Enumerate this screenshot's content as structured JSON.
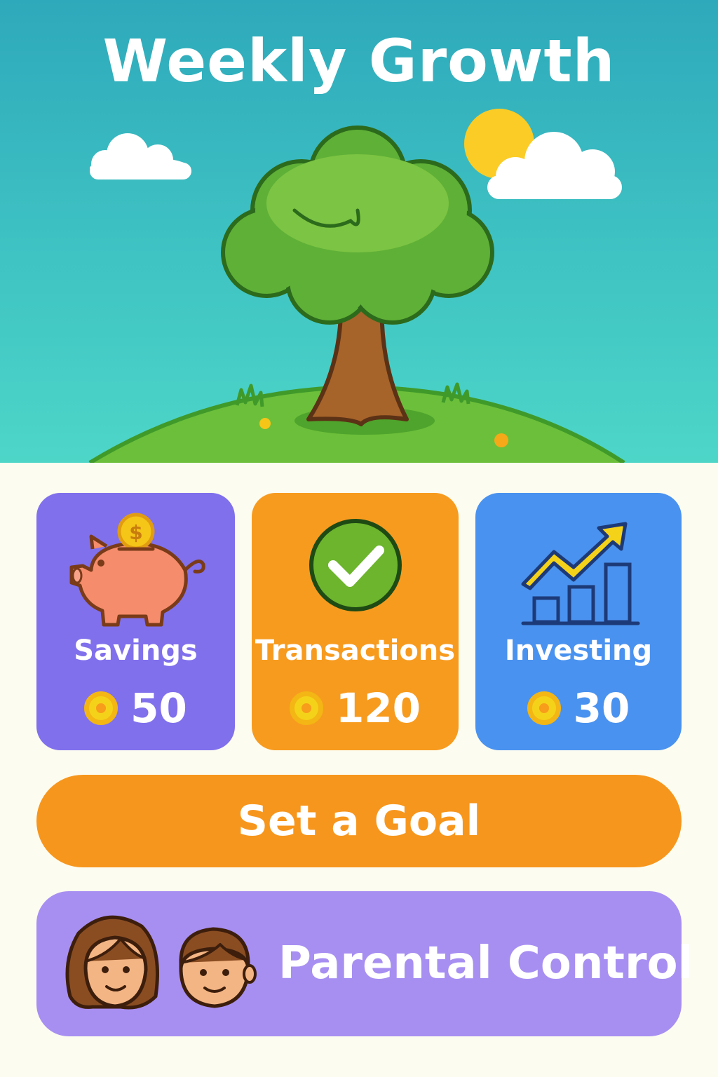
{
  "header": {
    "title": "Weekly Growth"
  },
  "cards": [
    {
      "label": "Savings",
      "value": "50",
      "icon": "piggy-bank-icon"
    },
    {
      "label": "Transactions",
      "value": "120",
      "icon": "checkmark-icon"
    },
    {
      "label": "Investing",
      "value": "30",
      "icon": "growth-chart-icon"
    }
  ],
  "actions": {
    "goal_label": "Set a Goal",
    "parental_label": "Parental Control"
  },
  "colors": {
    "savings": "#8070ec",
    "transactions": "#f79b1f",
    "investing": "#4a92ef",
    "goal_button": "#f7961c",
    "parental_button": "#a78ff2"
  }
}
